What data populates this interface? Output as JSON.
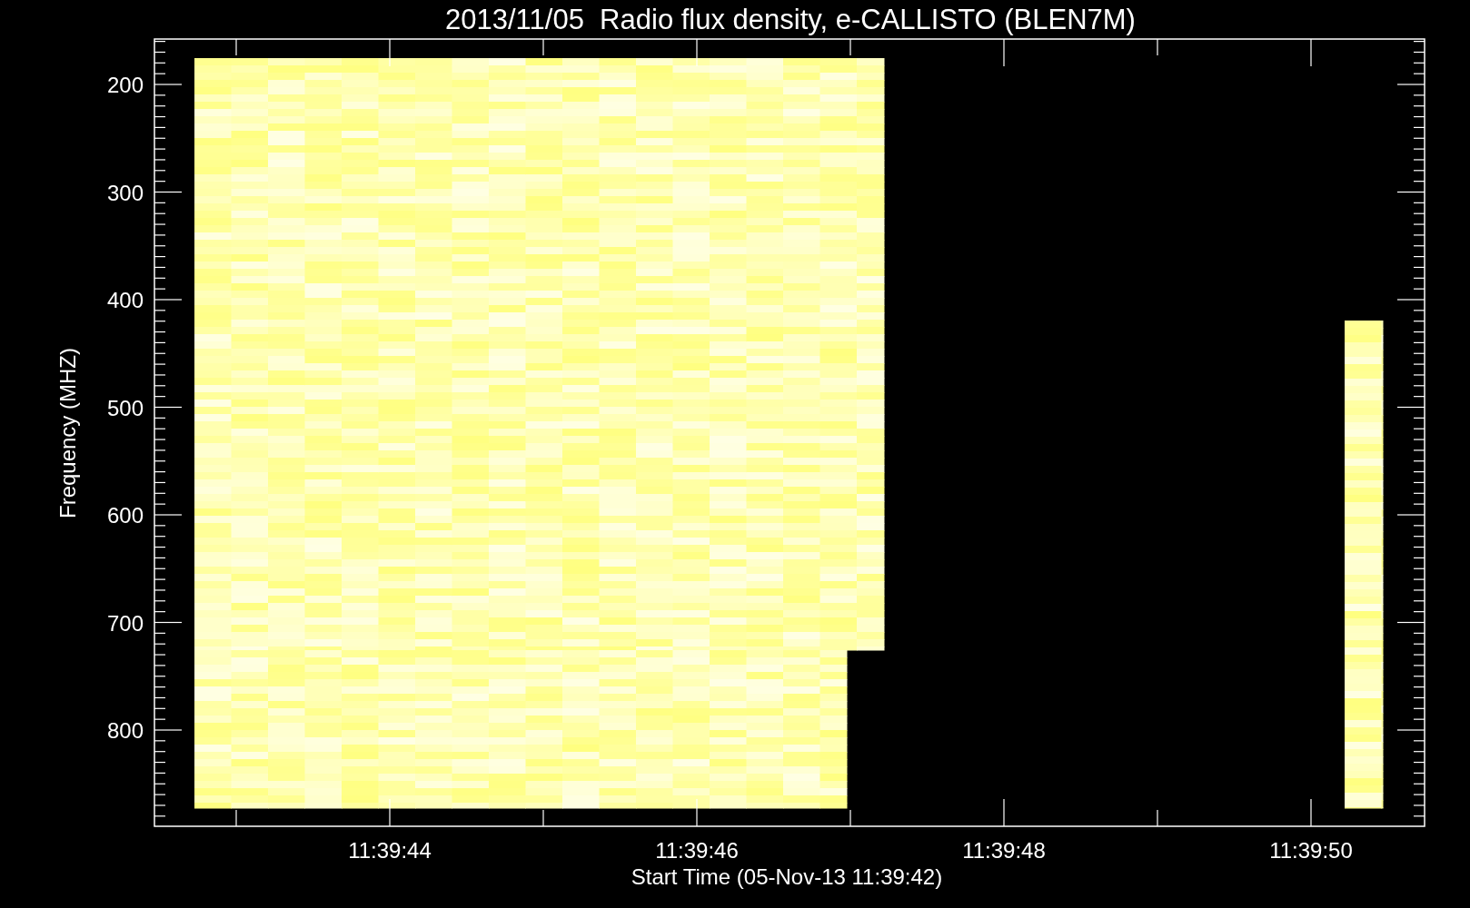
{
  "title": "2013/11/05  Radio flux density, e-CALLISTO (BLEN7M)",
  "plot": {
    "ylabel": "Frequency (MHZ)",
    "xlabel": "Start Time (05-Nov-13 11:39:42)",
    "yticks": [
      "200",
      "300",
      "400",
      "500",
      "600",
      "700",
      "800"
    ],
    "xticks": [
      "11:39:44",
      "11:39:46",
      "11:39:48",
      "11:39:50"
    ]
  }
}
